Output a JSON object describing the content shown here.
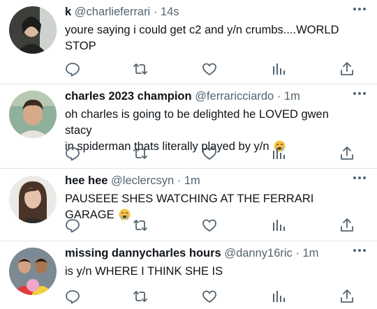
{
  "tweets": [
    {
      "name": "k",
      "handle": "@charlieferrari",
      "separator": "·",
      "time": "14s",
      "text_lines": [
        "youre saying i could get c2 and y/n crumbs....WORLD",
        "STOP"
      ],
      "emoji": ""
    },
    {
      "name": "charles 2023 champion",
      "handle": "@ferraricciardo",
      "separator": "·",
      "time": "1m",
      "text_lines": [
        "oh charles is going to be delighted he LOVED gwen stacy",
        "in spiderman thats literally played by y/n"
      ],
      "emoji": "crying-face-emoji"
    },
    {
      "name": "hee hee",
      "handle": "@leclercsyn",
      "separator": "·",
      "time": "1m",
      "text_lines": [
        "PAUSEEE SHES WATCHING AT THE FERRARI GARAGE"
      ],
      "emoji": "crying-face-emoji"
    },
    {
      "name": "missing dannycharles hours",
      "handle": "@danny16ric",
      "separator": "·",
      "time": "1m",
      "text_lines": [
        "is y/n WHERE I THINK SHE IS"
      ],
      "emoji": ""
    }
  ],
  "action_icons": [
    "reply-icon",
    "retweet-icon",
    "like-icon",
    "analytics-icon",
    "share-icon"
  ],
  "colors": {
    "text": "#0f1419",
    "secondary": "#536471",
    "divider": "#e1e4e8",
    "background": "#ffffff"
  }
}
